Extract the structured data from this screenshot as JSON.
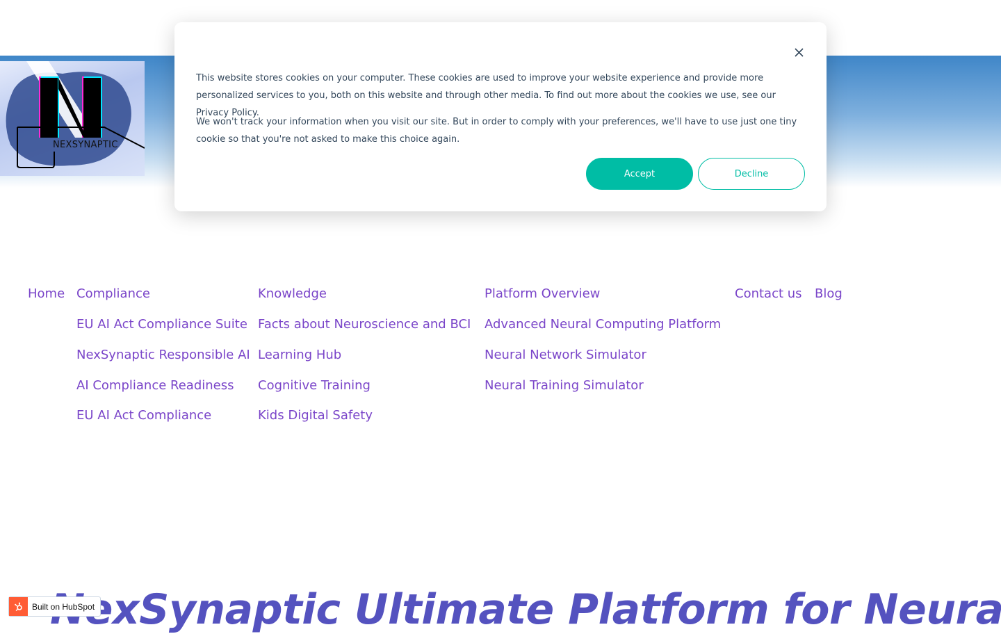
{
  "logo": {
    "text": "NEXSYNAPTIC"
  },
  "cookie_banner": {
    "paragraph_1": "This website stores cookies on your computer. These cookies are used to improve your website experience and provide more personalized services to you, both on this website and through other media. To find out more about the cookies we use, see our Privacy Policy.",
    "paragraph_2": "We won't track your information when you visit our site. But in order to comply with your preferences, we'll have to use just one tiny cookie so that you're not asked to make this choice again.",
    "accept_label": "Accept",
    "decline_label": "Decline",
    "close_icon": "close-icon",
    "accent_color": "#00bda5"
  },
  "nav": {
    "home": "Home",
    "compliance": {
      "label": "Compliance",
      "items": [
        "EU AI Act Compliance Suite",
        "NexSynaptic Responsible AI",
        "AI Compliance Readiness",
        "EU AI Act Compliance"
      ]
    },
    "knowledge": {
      "label": "Knowledge",
      "items": [
        "Facts about Neuroscience and BCI",
        "Learning Hub",
        "Cognitive Training",
        "Kids Digital Safety"
      ]
    },
    "platform": {
      "label": "Platform Overview",
      "items": [
        "Advanced Neural Computing Platform",
        "Neural Network Simulator",
        "Neural Training Simulator"
      ]
    },
    "contact": "Contact us",
    "blog": "Blog",
    "link_color": "#7a45c9"
  },
  "hero": {
    "title": "NexSynaptic Ultimate Platform for Neural"
  },
  "hubspot": {
    "label": "Built on HubSpot",
    "icon": "hubspot-sprocket-icon"
  }
}
